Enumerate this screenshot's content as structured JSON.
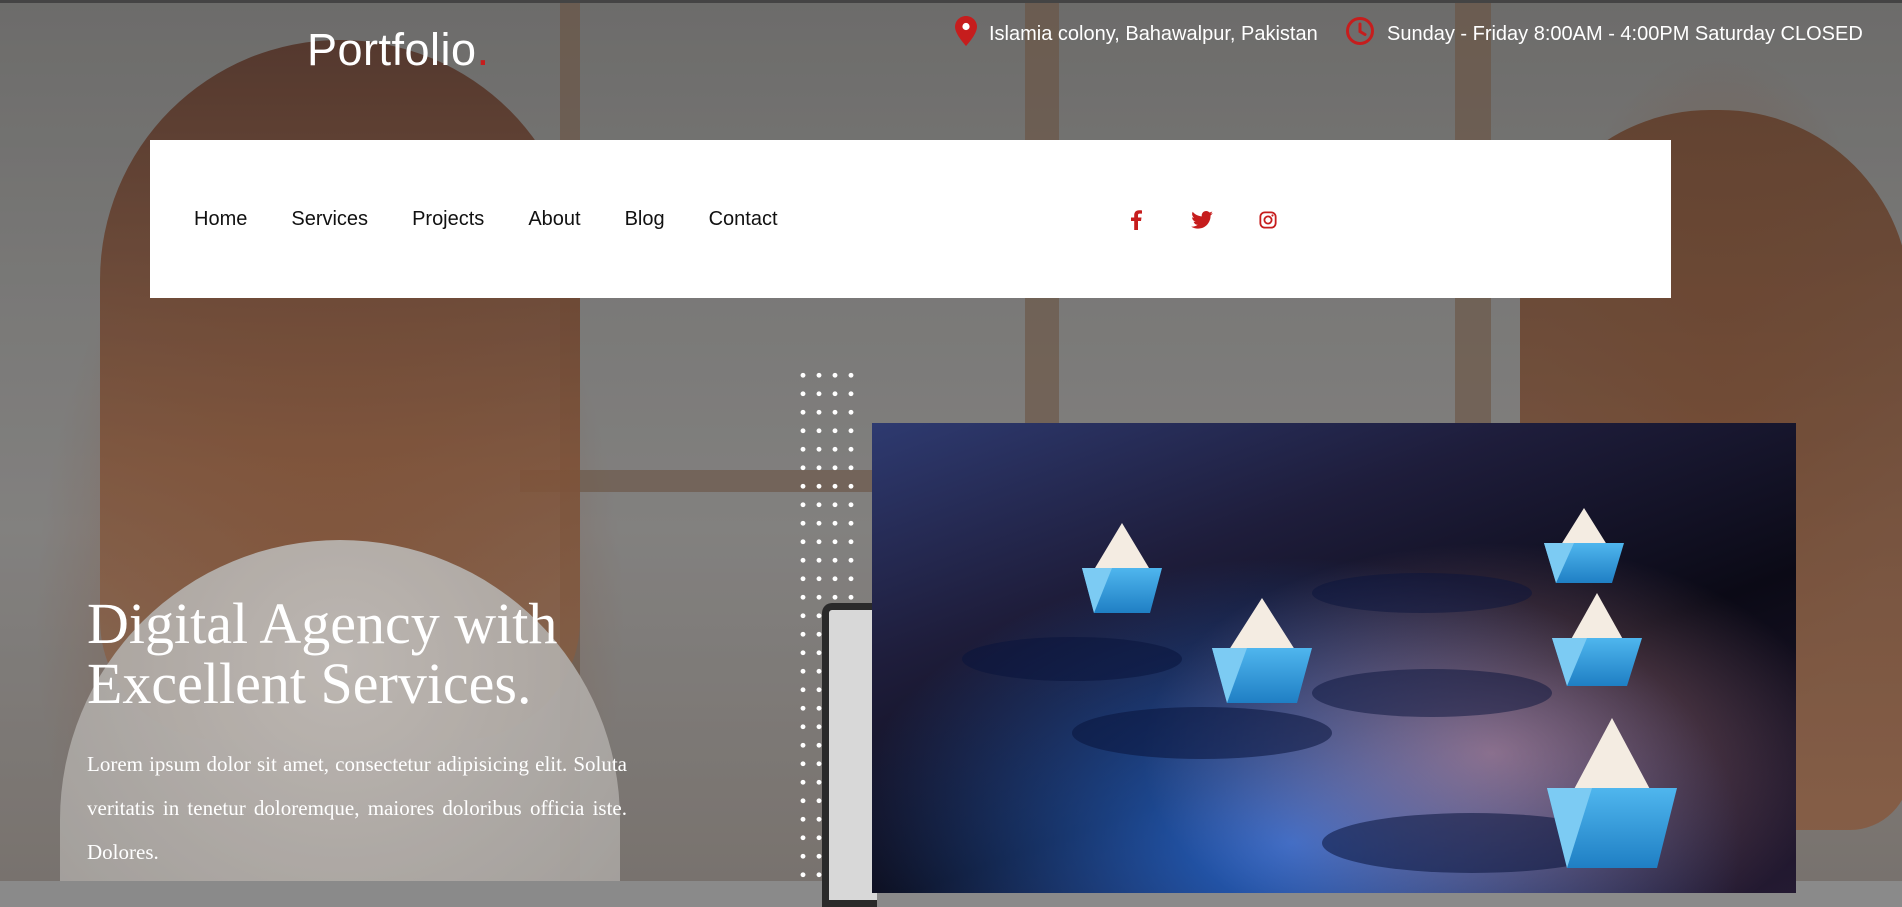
{
  "brand": {
    "name": "Portfolio",
    "dot": ".",
    "accent": "#c61d1d"
  },
  "topbar": {
    "address": "Islamia colony, Bahawalpur, Pakistan",
    "hours": "Sunday - Friday 8:00AM - 4:00PM Saturday CLOSED",
    "address_icon": "map-pin-icon",
    "hours_icon": "clock-icon"
  },
  "nav": {
    "items": [
      {
        "label": "Home"
      },
      {
        "label": "Services"
      },
      {
        "label": "Projects"
      },
      {
        "label": "About"
      },
      {
        "label": "Blog"
      },
      {
        "label": "Contact"
      }
    ],
    "socials": [
      "facebook-icon",
      "twitter-icon",
      "instagram-icon"
    ]
  },
  "hero": {
    "title_line1": "Digital Agency with",
    "title_line2": "Excellent Services.",
    "text": "Lorem ipsum dolor sit amet, consectetur adipisicing elit. Soluta veritatis in tenetur doloremque, maiores doloribus officia iste. Dolores."
  }
}
